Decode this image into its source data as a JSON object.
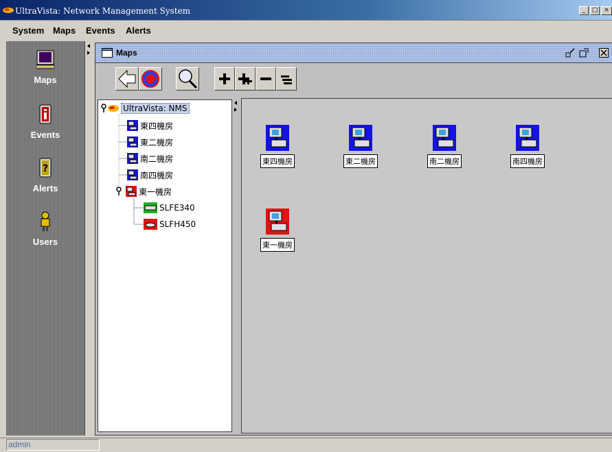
{
  "window": {
    "title": "UltraVista: Network Management System",
    "controls": [
      "minimize-icon",
      "maximize-icon",
      "close-icon"
    ]
  },
  "menu": {
    "items": [
      "System",
      "Maps",
      "Events",
      "Alerts"
    ]
  },
  "sidebar": {
    "items": [
      {
        "label": "Maps",
        "icon": "monitor-icon"
      },
      {
        "label": "Events",
        "icon": "info-icon"
      },
      {
        "label": "Alerts",
        "icon": "question-icon"
      },
      {
        "label": "Users",
        "icon": "user-icon"
      }
    ]
  },
  "maps_panel": {
    "title": "Maps",
    "toolbar": [
      "back-arrow-icon",
      "refresh-icon",
      "search-icon",
      "zoom-in-icon",
      "expand-icon",
      "zoom-out-icon",
      "collapse-icon"
    ]
  },
  "tree": {
    "root": "UltraVista: NMS",
    "children": [
      "東四機房",
      "東二機房",
      "南二機房",
      "南四機房",
      "東一機房"
    ],
    "devices": [
      "SLFE340",
      "SLFH450"
    ]
  },
  "map_nodes": [
    {
      "label": "東四機房",
      "status": "normal"
    },
    {
      "label": "東二機房",
      "status": "normal"
    },
    {
      "label": "南二機房",
      "status": "normal"
    },
    {
      "label": "南四機房",
      "status": "normal"
    },
    {
      "label": "東一機房",
      "status": "alarm"
    }
  ],
  "status_bar": {
    "user": "admin"
  },
  "colors": {
    "title_bar": "#0a246a",
    "node_normal": "#1414e0",
    "node_alarm": "#e01414",
    "sidebar": "#777777"
  }
}
